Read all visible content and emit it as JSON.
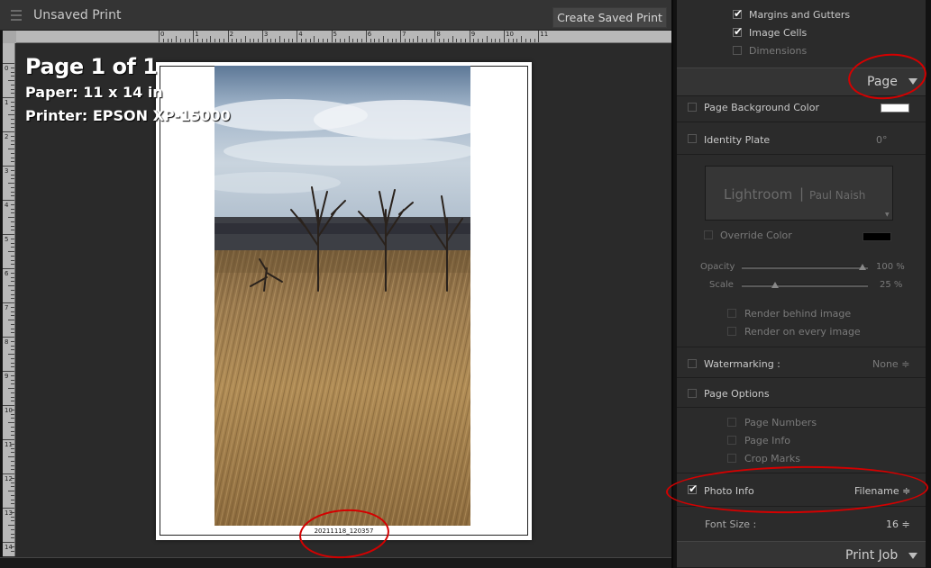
{
  "window": {
    "title": "Unsaved Print",
    "create_saved_label": "Create Saved Print"
  },
  "rulers": {
    "top_labels": [
      "0",
      "1",
      "2",
      "3",
      "4",
      "5",
      "6",
      "7",
      "8",
      "9",
      "10",
      "11"
    ],
    "left_labels": [
      "0",
      "1",
      "2",
      "3",
      "4",
      "5",
      "6",
      "7",
      "8",
      "9",
      "10",
      "11",
      "12",
      "13",
      "14"
    ]
  },
  "page_info": {
    "page_count": "Page 1 of 1",
    "paper": "Paper:  11 x 14 in",
    "printer": "Printer:  EPSON XP-15000"
  },
  "photo": {
    "caption": "20211118_120357"
  },
  "guides": {
    "margins_gutters": "Margins and Gutters",
    "margins_gutters_checked": true,
    "image_cells": "Image Cells",
    "image_cells_checked": true,
    "dimensions": "Dimensions",
    "dimensions_checked": false
  },
  "page_panel": {
    "title": "Page",
    "page_bg_color_label": "Page Background Color",
    "page_bg_color": "#ffffff",
    "identity_plate_label": "Identity Plate",
    "identity_plate_angle": "0°",
    "identity_plate_text_main": "Lightroom",
    "identity_plate_text_user": "Paul Naish",
    "override_color_label": "Override Color",
    "override_color": "#000000",
    "opacity_label": "Opacity",
    "opacity_value": "100 %",
    "opacity_fraction": 1.0,
    "scale_label": "Scale",
    "scale_value": "25 %",
    "scale_fraction": 0.25,
    "render_behind_label": "Render behind image",
    "render_every_label": "Render on every image",
    "watermarking_label": "Watermarking :",
    "watermarking_value": "None ≑",
    "page_options_label": "Page Options",
    "page_numbers_label": "Page Numbers",
    "page_info_label": "Page Info",
    "crop_marks_label": "Crop Marks",
    "photo_info_label": "Photo Info",
    "photo_info_checked": true,
    "photo_info_value": "Filename ≑",
    "font_size_label": "Font Size :",
    "font_size_value": "16 ≑"
  },
  "print_job": {
    "title": "Print Job"
  },
  "colors": {
    "annotation_red": "#d40000",
    "panel_bg": "#2b2b2b"
  }
}
